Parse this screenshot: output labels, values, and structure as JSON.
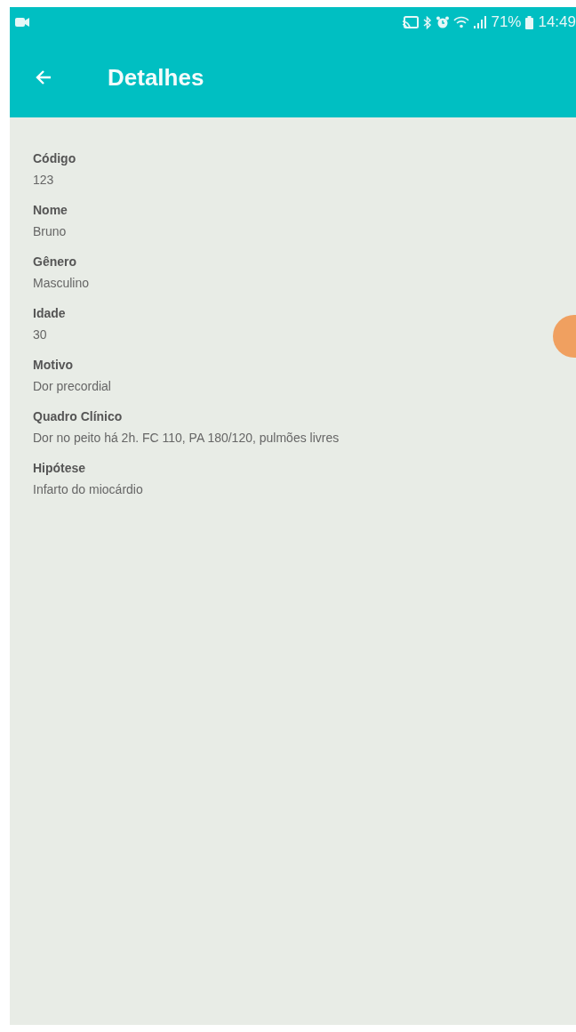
{
  "status_bar": {
    "battery": "71%",
    "time": "14:49"
  },
  "app_bar": {
    "title": "Detalhes"
  },
  "fields": [
    {
      "label": "Código",
      "value": "123"
    },
    {
      "label": "Nome",
      "value": "Bruno"
    },
    {
      "label": "Gênero",
      "value": "Masculino"
    },
    {
      "label": "Idade",
      "value": "30"
    },
    {
      "label": "Motivo",
      "value": "Dor precordial"
    },
    {
      "label": "Quadro Clínico",
      "value": "Dor no peito há 2h. FC 110, PA 180/120, pulmões livres"
    },
    {
      "label": "Hipótese",
      "value": "Infarto do miocárdio"
    }
  ]
}
